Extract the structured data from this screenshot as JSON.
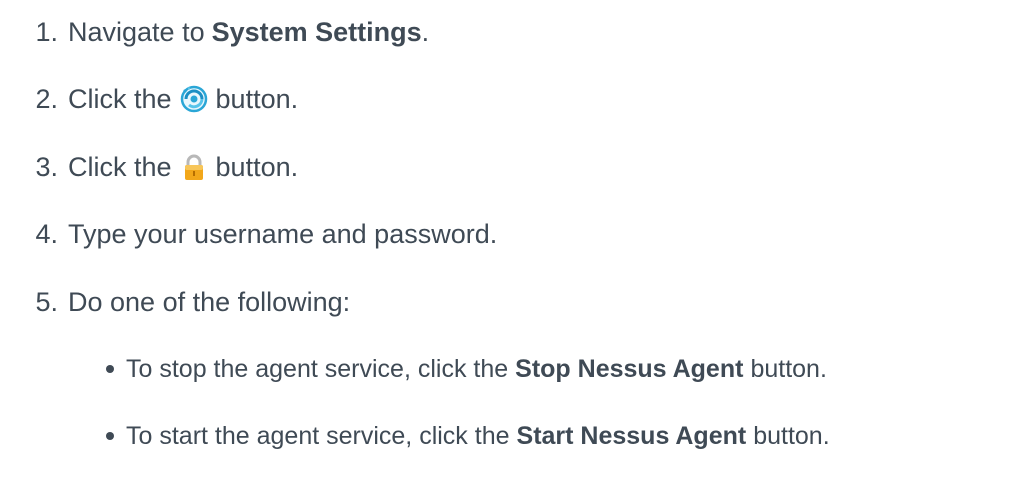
{
  "steps": [
    {
      "num": "1.",
      "prefix": "Navigate to ",
      "bold": "System Settings",
      "suffix": "."
    },
    {
      "num": "2.",
      "prefix": "Click the",
      "icon": "settings-swirl-icon",
      "suffix": "button."
    },
    {
      "num": "3.",
      "prefix": "Click the",
      "icon": "lock-icon",
      "suffix": "button."
    },
    {
      "num": "4.",
      "text": "Type your username and password."
    },
    {
      "num": "5.",
      "text": "Do one of the following:"
    }
  ],
  "bullets": [
    {
      "prefix": "To stop the agent service, click the ",
      "bold": "Stop Nessus Agent",
      "suffix": " button."
    },
    {
      "prefix": "To start the agent service, click the ",
      "bold": "Start Nessus Agent",
      "suffix": " button."
    }
  ],
  "colors": {
    "text": "#3f4a55",
    "swirl": "#2aa6d6",
    "lock_body": "#f2a71a",
    "lock_shackle": "#b8b8b8"
  }
}
